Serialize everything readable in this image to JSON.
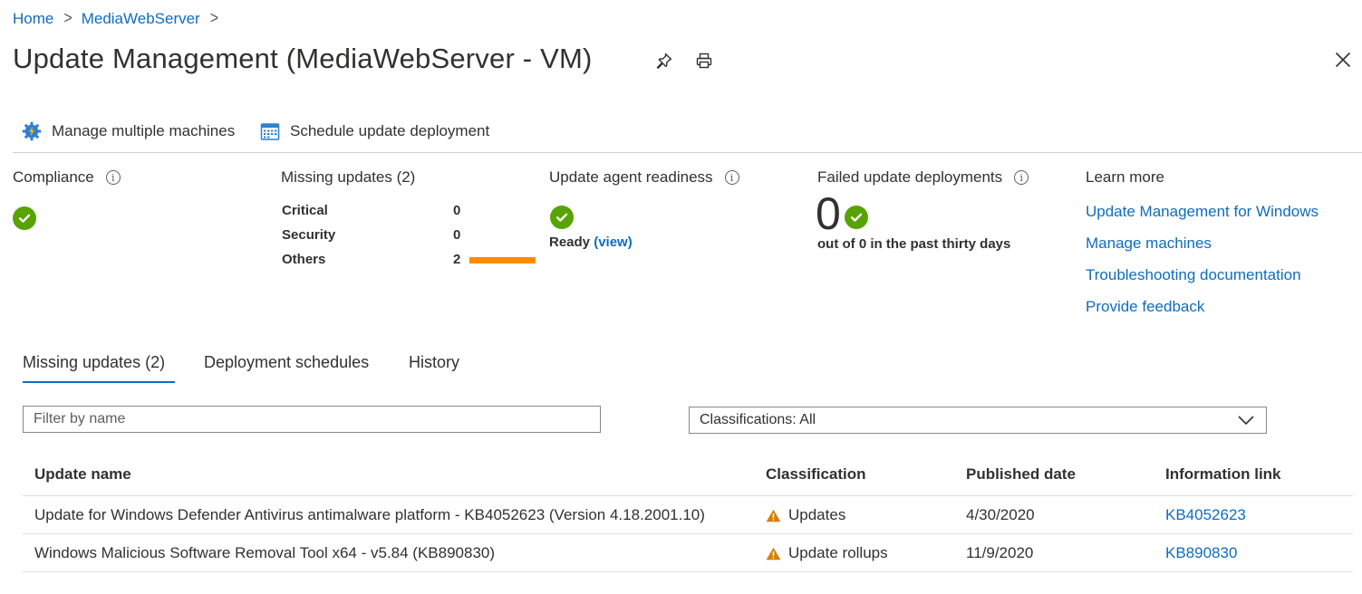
{
  "breadcrumb": {
    "home": "Home",
    "server": "MediaWebServer",
    "separator": ">"
  },
  "page": {
    "title": "Update Management (MediaWebServer - VM)"
  },
  "toolbar": {
    "manage_label": "Manage multiple machines",
    "schedule_label": "Schedule update deployment"
  },
  "summary": {
    "compliance": {
      "title": "Compliance",
      "status": "compliant"
    },
    "missing": {
      "title": "Missing updates (2)",
      "rows": [
        {
          "label": "Critical",
          "value": "0"
        },
        {
          "label": "Security",
          "value": "0"
        },
        {
          "label": "Others",
          "value": "2"
        }
      ]
    },
    "agent": {
      "title": "Update agent readiness",
      "status": "Ready",
      "view_link": "(view)"
    },
    "failed": {
      "title": "Failed update deployments",
      "count": "0",
      "description": "out of 0 in the past thirty days"
    },
    "learn_more": {
      "title": "Learn more",
      "links": [
        "Update Management for Windows",
        "Manage machines",
        "Troubleshooting documentation",
        "Provide feedback"
      ]
    }
  },
  "tabs": [
    {
      "label": "Missing updates (2)",
      "active": true
    },
    {
      "label": "Deployment schedules",
      "active": false
    },
    {
      "label": "History",
      "active": false
    }
  ],
  "filters": {
    "name_placeholder": "Filter by name",
    "classification_value": "Classifications: All"
  },
  "table": {
    "headers": [
      "Update name",
      "Classification",
      "Published date",
      "Information link"
    ],
    "rows": [
      {
        "name": "Update for Windows Defender Antivirus antimalware platform - KB4052623 (Version 4.18.2001.10)",
        "classification": "Updates",
        "published": "4/30/2020",
        "link": "KB4052623"
      },
      {
        "name": "Windows Malicious Software Removal Tool x64 - v5.84 (KB890830)",
        "classification": "Update rollups",
        "published": "11/9/2020",
        "link": "KB890830"
      }
    ]
  },
  "colors": {
    "accent": "#0f6cbd",
    "success": "#57a300",
    "warning": "#ff8c00",
    "warning_icon": "#d67f00"
  },
  "icons": {
    "pin": "pin-icon",
    "print": "print-icon",
    "close": "close-icon",
    "manage": "gear-lightning-icon",
    "schedule": "calendar-icon",
    "info": "info-icon",
    "check": "check-circle-icon",
    "warning": "warning-icon",
    "dropdown": "chevron-down-icon"
  }
}
